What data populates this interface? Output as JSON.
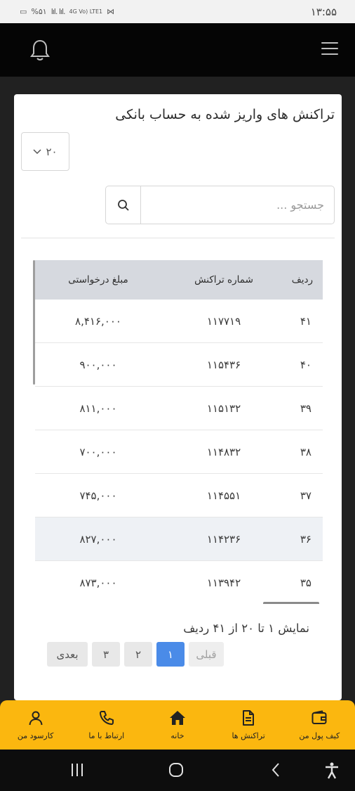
{
  "status_bar": {
    "time": "۱۳:۵۵",
    "battery": "%۵۱",
    "network": "4G Vo) LTE1"
  },
  "header": {
    "menu_icon": "hamburger-icon",
    "notification_icon": "bell-icon"
  },
  "card": {
    "title": "تراکنش های واریز شده به حساب بانکی",
    "page_size": "۲۰",
    "search_placeholder": "جستجو ...",
    "search_icon": "search-icon"
  },
  "table": {
    "columns": [
      "ردیف",
      "شماره تراکنش",
      "مبلغ درخواستی"
    ],
    "rows": [
      {
        "index": "۴۱",
        "transaction": "۱۱۷۷۱۹",
        "amount": "۸,۴۱۶,۰۰۰"
      },
      {
        "index": "۴۰",
        "transaction": "۱۱۵۴۳۶",
        "amount": "۹۰۰,۰۰۰"
      },
      {
        "index": "۳۹",
        "transaction": "۱۱۵۱۳۲",
        "amount": "۸۱۱,۰۰۰"
      },
      {
        "index": "۳۸",
        "transaction": "۱۱۴۸۳۲",
        "amount": "۷۰۰,۰۰۰"
      },
      {
        "index": "۳۷",
        "transaction": "۱۱۴۵۵۱",
        "amount": "۷۴۵,۰۰۰"
      },
      {
        "index": "۳۶",
        "transaction": "۱۱۴۲۳۶",
        "amount": "۸۲۷,۰۰۰"
      },
      {
        "index": "۳۵",
        "transaction": "۱۱۳۹۴۲",
        "amount": "۸۷۳,۰۰۰"
      }
    ]
  },
  "pagination": {
    "summary": "نمایش ۱ تا ۲۰ از ۴۱ ردیف",
    "next": "بعدی",
    "pages": [
      "۳",
      "۲",
      "۱"
    ],
    "prev": "قبلی",
    "active_page": "۱"
  },
  "bottom_nav": [
    {
      "label": "کارسود من",
      "icon": "user-icon"
    },
    {
      "label": "ارتباط با ما",
      "icon": "phone-icon"
    },
    {
      "label": "خانه",
      "icon": "home-icon"
    },
    {
      "label": "تراکنش ها",
      "icon": "document-icon"
    },
    {
      "label": "کیف پول من",
      "icon": "wallet-icon"
    }
  ],
  "system_nav": {
    "recents_icon": "recents-icon",
    "home_icon": "home-circle-icon",
    "back_icon": "back-icon",
    "accessibility_icon": "accessibility-icon"
  },
  "colors": {
    "accent": "#fbb70f",
    "header_bg": "#050505",
    "active_page": "#4a8be8",
    "table_header": "#d6d9df"
  }
}
